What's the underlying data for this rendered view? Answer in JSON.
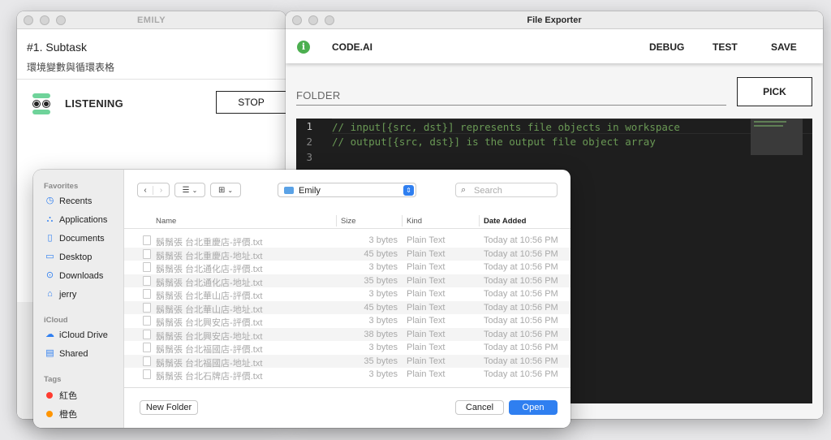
{
  "emily_window": {
    "title": "EMILY",
    "task_title": "#1. Subtask",
    "task_subtitle": "環境變數與循環表格",
    "status_label": "LISTENING",
    "stop_label": "STOP"
  },
  "exporter_window": {
    "title": "File Exporter",
    "app_name": "CODE.AI",
    "menu": [
      "DEBUG",
      "TEST",
      "SAVE"
    ],
    "folder_label": "FOLDER",
    "pick_label": "PICK",
    "editor": {
      "line_numbers": [
        "1",
        "2",
        "3"
      ],
      "lines": [
        "// input[{src, dst}] represents file objects in workspace",
        "// output[{src, dst}] is the output file object array",
        ""
      ]
    }
  },
  "file_dialog": {
    "sidebar": {
      "favorites_header": "Favorites",
      "favorites": [
        {
          "label": "Recents",
          "icon": "clock-icon"
        },
        {
          "label": "Applications",
          "icon": "applications-icon"
        },
        {
          "label": "Documents",
          "icon": "document-icon"
        },
        {
          "label": "Desktop",
          "icon": "desktop-icon"
        },
        {
          "label": "Downloads",
          "icon": "download-icon"
        },
        {
          "label": "jerry",
          "icon": "home-icon"
        }
      ],
      "icloud_header": "iCloud",
      "icloud": [
        {
          "label": "iCloud Drive",
          "icon": "cloud-icon"
        },
        {
          "label": "Shared",
          "icon": "shared-folder-icon"
        }
      ],
      "tags_header": "Tags",
      "tags": [
        {
          "label": "紅色",
          "color": "#ff3b30"
        },
        {
          "label": "橙色",
          "color": "#ff9500"
        }
      ]
    },
    "toolbar": {
      "location": "Emily",
      "search_placeholder": "Search"
    },
    "columns": {
      "name": "Name",
      "size": "Size",
      "kind": "Kind",
      "date": "Date Added"
    },
    "files": [
      {
        "name": "鬍鬚張 台北重慶店-評價.txt",
        "size": "3 bytes",
        "kind": "Plain Text",
        "date": "Today at 10:56 PM"
      },
      {
        "name": "鬍鬚張 台北重慶店-地址.txt",
        "size": "45 bytes",
        "kind": "Plain Text",
        "date": "Today at 10:56 PM"
      },
      {
        "name": "鬍鬚張 台北通化店-評價.txt",
        "size": "3 bytes",
        "kind": "Plain Text",
        "date": "Today at 10:56 PM"
      },
      {
        "name": "鬍鬚張 台北通化店-地址.txt",
        "size": "35 bytes",
        "kind": "Plain Text",
        "date": "Today at 10:56 PM"
      },
      {
        "name": "鬍鬚張 台北華山店-評價.txt",
        "size": "3 bytes",
        "kind": "Plain Text",
        "date": "Today at 10:56 PM"
      },
      {
        "name": "鬍鬚張 台北華山店-地址.txt",
        "size": "45 bytes",
        "kind": "Plain Text",
        "date": "Today at 10:56 PM"
      },
      {
        "name": "鬍鬚張 台北興安店-評價.txt",
        "size": "3 bytes",
        "kind": "Plain Text",
        "date": "Today at 10:56 PM"
      },
      {
        "name": "鬍鬚張 台北興安店-地址.txt",
        "size": "38 bytes",
        "kind": "Plain Text",
        "date": "Today at 10:56 PM"
      },
      {
        "name": "鬍鬚張 台北福國店-評價.txt",
        "size": "3 bytes",
        "kind": "Plain Text",
        "date": "Today at 10:56 PM"
      },
      {
        "name": "鬍鬚張 台北福國店-地址.txt",
        "size": "35 bytes",
        "kind": "Plain Text",
        "date": "Today at 10:56 PM"
      },
      {
        "name": "鬍鬚張 台北石牌店-評價.txt",
        "size": "3 bytes",
        "kind": "Plain Text",
        "date": "Today at 10:56 PM"
      }
    ],
    "new_folder_label": "New Folder",
    "cancel_label": "Cancel",
    "open_label": "Open"
  }
}
